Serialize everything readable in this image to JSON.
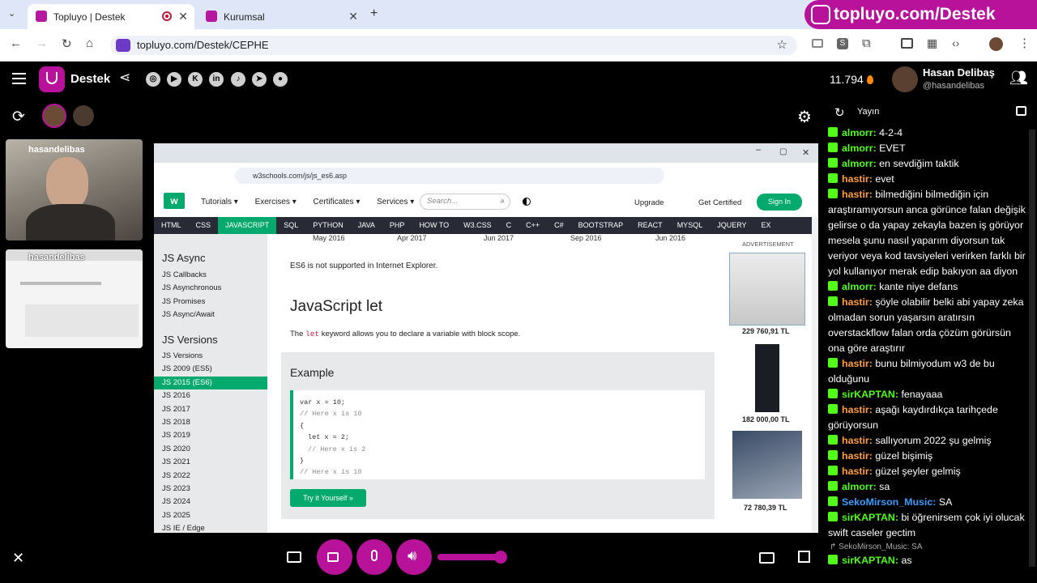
{
  "browser": {
    "tabs": [
      {
        "label": "Topluyo | Destek"
      },
      {
        "label": "Kurumsal"
      }
    ],
    "promo_text": "topluyo.com/Destek",
    "url": "topluyo.com/Destek/CEPHE"
  },
  "app": {
    "channel_name": "Destek",
    "points": "11.794",
    "user_name": "Hasan Delibaş",
    "user_handle": "@hasandelibas",
    "chat_tab_label": "Yayın",
    "social_icons": [
      "instagram-icon",
      "youtube-icon",
      "kick-icon",
      "linkedin-icon",
      "tiktok-icon",
      "telegram-icon",
      "github-icon"
    ],
    "cam_label_1": "hasandelibas",
    "cam_label_2": "hasandelibas"
  },
  "screen": {
    "url": "w3schools.com/js/js_es6.asp",
    "menu": {
      "tutorials": "Tutorials",
      "exercises": "Exercises",
      "certificates": "Certificates",
      "services": "Services",
      "search_placeholder": "Search...",
      "upgrade": "Upgrade",
      "get_certified": "Get Certified",
      "sign_in": "Sign In"
    },
    "topnav": [
      "HTML",
      "CSS",
      "JAVASCRIPT",
      "SQL",
      "PYTHON",
      "JAVA",
      "PHP",
      "HOW TO",
      "W3.CSS",
      "C",
      "C++",
      "C#",
      "BOOTSTRAP",
      "REACT",
      "MYSQL",
      "JQUERY",
      "EX"
    ],
    "dates": [
      "May 2016",
      "Apr 2017",
      "Jun 2017",
      "Sep 2016",
      "Jun 2016"
    ],
    "sidebar": {
      "heading_async": "JS Async",
      "async_items": [
        "JS Callbacks",
        "JS Asynchronous",
        "JS Promises",
        "JS Async/Await"
      ],
      "heading_versions": "JS Versions",
      "version_items": [
        "JS Versions",
        "JS 2009 (ES5)",
        "JS 2015 (ES6)",
        "JS 2016",
        "JS 2017",
        "JS 2018",
        "JS 2019",
        "JS 2020",
        "JS 2021",
        "JS 2022",
        "JS 2023",
        "JS 2024",
        "JS 2025",
        "JS IE / Edge"
      ]
    },
    "content": {
      "ie_note": "ES6 is not supported in Internet Explorer.",
      "heading": "JavaScript let",
      "desc_pre": "The",
      "desc_kw": "let",
      "desc_post": "keyword allows you to declare a variable with block scope.",
      "example_title": "Example",
      "code": [
        "var x = 10;",
        "// Here x is 10",
        "{",
        "let x = 2;",
        "// Here x is 2",
        "}",
        "// Here x is 10"
      ],
      "try_button": "Try it Yourself »"
    },
    "ads": {
      "label": "ADVERTISEMENT",
      "prices": [
        "229 760,91 TL",
        "182 000,00 TL",
        "72 780,39 TL"
      ]
    }
  },
  "chat": [
    {
      "user": "almorr",
      "color": "#53fc18",
      "text": "4-2-4"
    },
    {
      "user": "almorr",
      "color": "#53fc18",
      "text": "EVET"
    },
    {
      "user": "almorr",
      "color": "#53fc18",
      "text": "en sevdiğim taktik"
    },
    {
      "user": "hastir",
      "color": "#ff9f40",
      "text": "evet"
    },
    {
      "user": "hastir",
      "color": "#ff9f40",
      "text": "bilmediğini bilmediğin için araştıramıyorsun anca görünce falan değişik gelirse o da yapay zekayla bazen iş görüyor mesela şunu nasıl yaparım diyorsun tak veriyor veya kod tavsiyeleri verirken farklı bir yol kullanıyor merak edip bakıyon aa diyon"
    },
    {
      "user": "almorr",
      "color": "#53fc18",
      "text": "kante niye defans"
    },
    {
      "user": "hastir",
      "color": "#ff9f40",
      "text": "şöyle olabilir belki abi yapay zeka olmadan sorun yaşarsın aratırsın overstackflow falan orda çözüm görürsün ona göre araştırır"
    },
    {
      "user": "hastir",
      "color": "#ff9f40",
      "text": "bunu bilmiyodum w3 de bu olduğunu"
    },
    {
      "user": "sirKAPTAN",
      "color": "#53fc18",
      "text": "fenayaaa"
    },
    {
      "user": "hastir",
      "color": "#ff9f40",
      "text": "aşağı kaydırdıkça tarihçede görüyorsun"
    },
    {
      "user": "hastir",
      "color": "#ff9f40",
      "text": "sallıyorum 2022 şu gelmiş"
    },
    {
      "user": "hastir",
      "color": "#ff9f40",
      "text": "güzel bişimiş"
    },
    {
      "user": "hastir",
      "color": "#ff9f40",
      "text": "güzel şeyler gelmiş"
    },
    {
      "user": "almorr",
      "color": "#53fc18",
      "text": "sa"
    },
    {
      "user": "SekoMirson_Music",
      "color": "#3b9cff",
      "text": "SA"
    },
    {
      "user": "sirKAPTAN",
      "color": "#53fc18",
      "text": "bi öğrenirsem çok iyi olucak swift caseler gectim"
    },
    {
      "user": "sirKAPTAN",
      "color": "#53fc18",
      "text": "as"
    }
  ],
  "reply_ref": "↱ SekoMirson_Music: SA"
}
